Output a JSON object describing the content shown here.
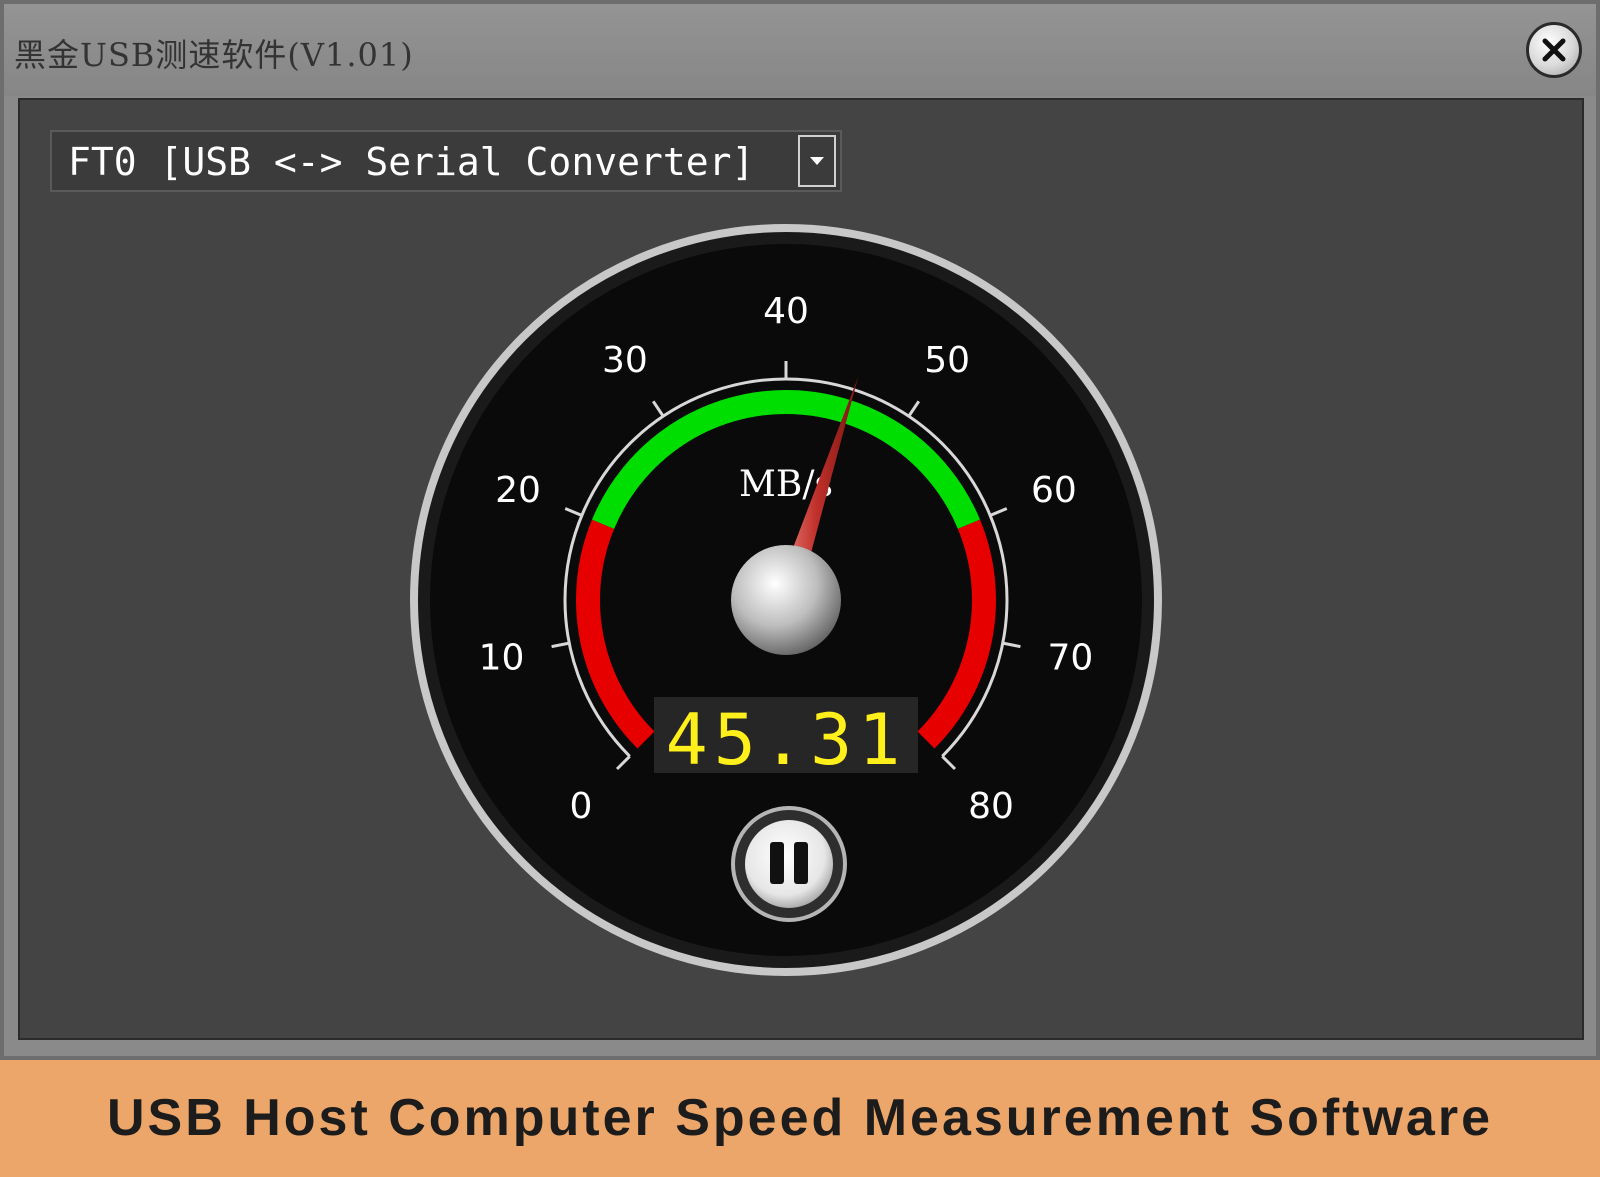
{
  "window": {
    "title": "黑金USB测速软件(V1.01)",
    "close_icon": "close-icon"
  },
  "device_select": {
    "selected": "FT0 [USB <-> Serial Converter]",
    "dropdown_icon": "chevron-down-icon"
  },
  "gauge": {
    "unit": "MB/s",
    "min": 0,
    "max": 80,
    "tick_labels": [
      "0",
      "10",
      "20",
      "30",
      "40",
      "50",
      "60",
      "70",
      "80"
    ],
    "value": 45.31,
    "display": "45.31",
    "zones": [
      {
        "from": 0,
        "to": 20,
        "color": "#e60000"
      },
      {
        "from": 20,
        "to": 60,
        "color": "#00dd00"
      },
      {
        "from": 60,
        "to": 80,
        "color": "#e60000"
      }
    ],
    "needle_color": "#c0302a",
    "display_color": "#ffef1a",
    "pause_icon": "pause-icon"
  },
  "banner": {
    "text": "USB Host Computer Speed Measurement Software"
  }
}
